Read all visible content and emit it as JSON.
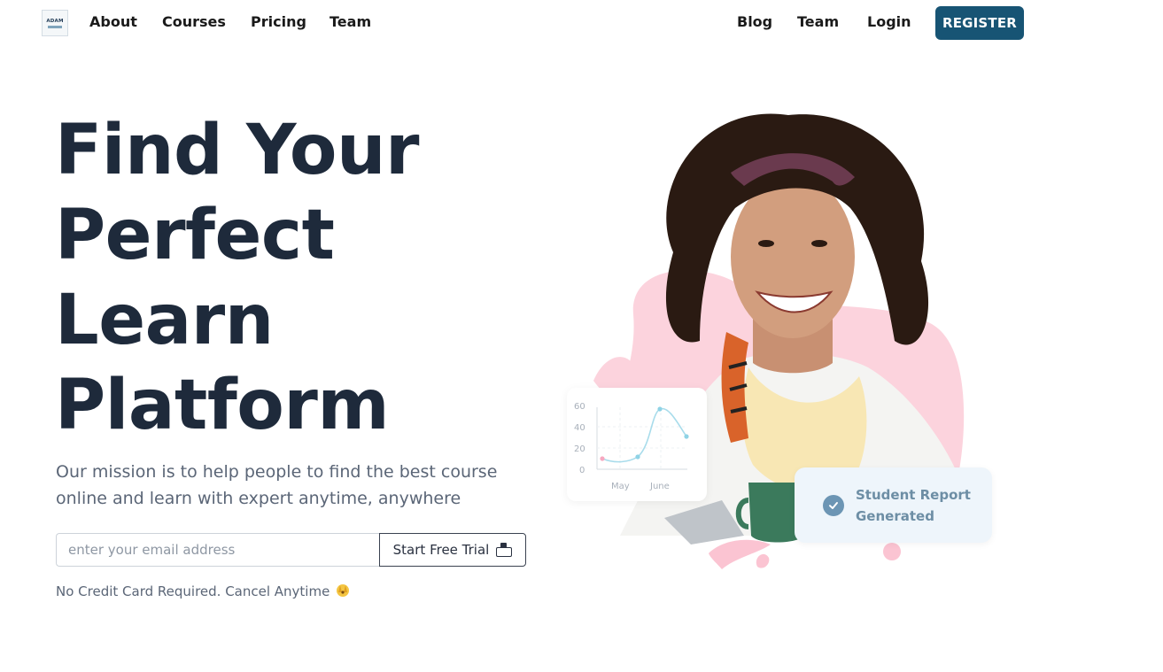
{
  "nav": {
    "logo_text": "ADAM",
    "left_links": [
      "About",
      "Courses",
      "Pricing",
      "Team"
    ],
    "right_links": [
      "Blog",
      "Team",
      "Login"
    ],
    "register_label": "REGISTER"
  },
  "hero": {
    "title_lines": [
      "Find Your",
      "Perfect",
      "Learn",
      "Platform"
    ],
    "mission_line1": "Our mission is to help people to find the best course",
    "mission_line2": "online and learn with expert anytime, anywhere",
    "email_placeholder": "enter your email address",
    "trial_label": "Start Free Trial",
    "note": "No Credit Card Required. Cancel Anytime",
    "note_icon": "hands-emoji"
  },
  "chart_card": {
    "y_ticks": [
      "60",
      "40",
      "20",
      "0"
    ],
    "x_ticks": [
      "May",
      "June"
    ]
  },
  "report_card": {
    "line1": "Student Report",
    "line2": "Generated"
  },
  "colors": {
    "accent": "#175474",
    "heading": "#1e2a3b",
    "pink_blob": "#fcd3dd",
    "report_bg": "#eef5fb"
  }
}
